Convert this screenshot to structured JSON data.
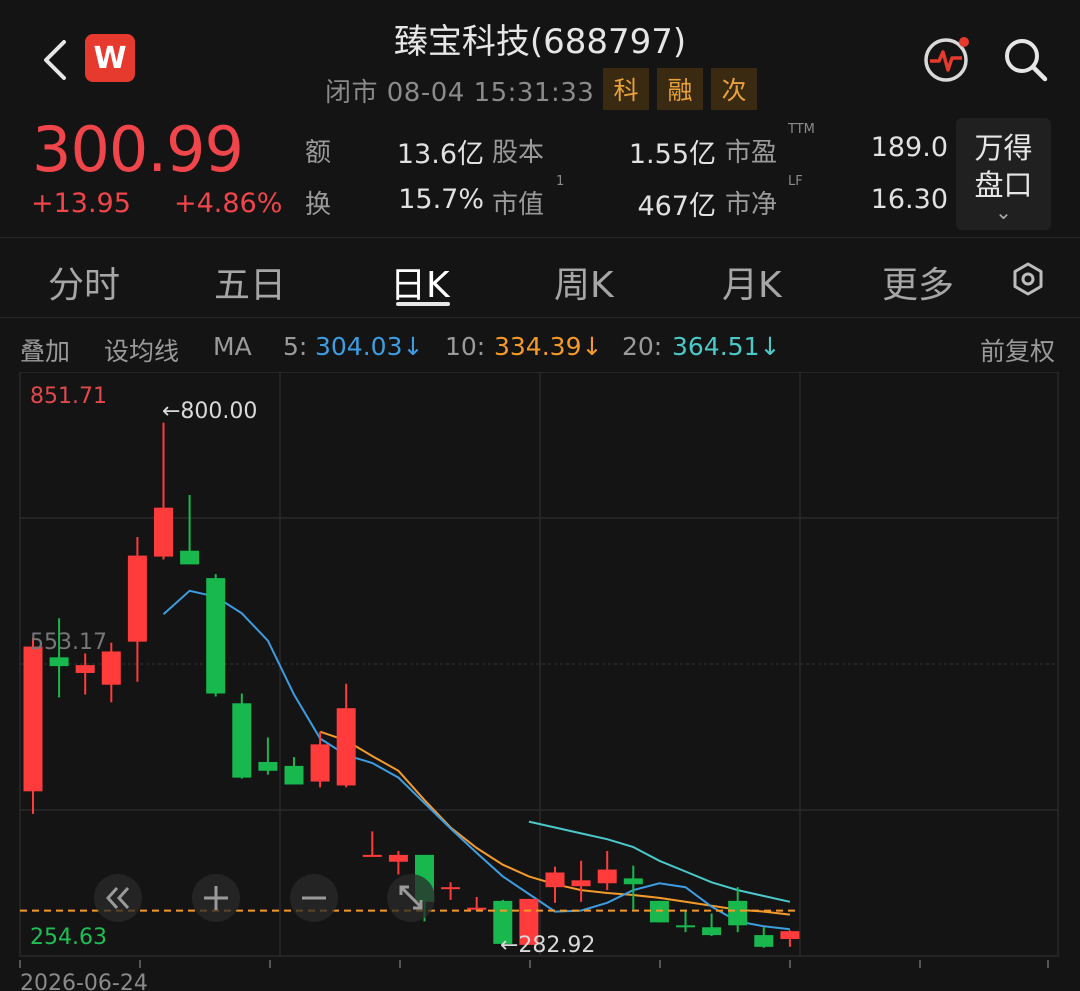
{
  "header": {
    "title": "臻宝科技(688797)",
    "status": "闭市 08-04 15:31:33",
    "tags": [
      "科",
      "融",
      "次"
    ],
    "logo_letter": "W",
    "back_icon": "chevron-left-icon",
    "pulse_icon": "heart-rate-icon",
    "search_icon": "search-icon"
  },
  "quote": {
    "price": "300.99",
    "change": "+13.95",
    "change_pct": "+4.86%",
    "stats": [
      {
        "label": "额",
        "value": "13.6亿"
      },
      {
        "label": "股本",
        "value": "1.55亿"
      },
      {
        "label": "市盈",
        "sup": "TTM",
        "value": "189.0"
      },
      {
        "label": "换",
        "value": "15.7%"
      },
      {
        "label": "市值",
        "sup": "1",
        "value": "467亿"
      },
      {
        "label": "市净",
        "sup": "LF",
        "value": "16.30"
      }
    ],
    "pankou_label": "万得\n盘口",
    "pankou_line1": "万得",
    "pankou_line2": "盘口",
    "pankou_caret": "⌄"
  },
  "tabs": [
    {
      "label": "分时"
    },
    {
      "label": "五日"
    },
    {
      "label": "日K",
      "active": true
    },
    {
      "label": "周K"
    },
    {
      "label": "月K"
    },
    {
      "label": "更多"
    }
  ],
  "toolbar": {
    "overlay": "叠加",
    "set_ma": "设均线",
    "ma": "MA",
    "ma5_label": "5:",
    "ma5_value": "304.03↓",
    "ma10_label": "10:",
    "ma10_value": "334.39↓",
    "ma20_label": "20:",
    "ma20_value": "364.51↓",
    "adjust": "前复权"
  },
  "colors": {
    "up": "#ff3b3b",
    "down": "#18b84f",
    "ma5": "#3d9de0",
    "ma10": "#f39a2b",
    "ma20": "#4bc9c9",
    "last_price_line": "#f39a2b"
  },
  "chart_data": {
    "type": "candlestick",
    "y_top_label": "851.71",
    "y_mid_label": "553.17",
    "y_bottom_label": "254.63",
    "ylim": [
      254.63,
      851.71
    ],
    "max_label": "←800.00",
    "min_label": "←282.92",
    "x_start_label": "2026-06-24",
    "last_price": 300.99,
    "candles": [
      {
        "o": 423,
        "h": 580,
        "l": 400,
        "c": 571
      },
      {
        "o": 560,
        "h": 600,
        "l": 519,
        "c": 551
      },
      {
        "o": 544,
        "h": 564,
        "l": 522,
        "c": 552
      },
      {
        "o": 532,
        "h": 575,
        "l": 514,
        "c": 566
      },
      {
        "o": 576,
        "h": 683,
        "l": 535,
        "c": 664
      },
      {
        "o": 663,
        "h": 800,
        "l": 660,
        "c": 713
      },
      {
        "o": 669,
        "h": 726,
        "l": 661,
        "c": 655
      },
      {
        "o": 641,
        "h": 645,
        "l": 520,
        "c": 523
      },
      {
        "o": 513,
        "h": 523,
        "l": 436,
        "c": 437
      },
      {
        "o": 453,
        "h": 478,
        "l": 440,
        "c": 444
      },
      {
        "o": 449,
        "h": 458,
        "l": 430,
        "c": 430
      },
      {
        "o": 433,
        "h": 484,
        "l": 427,
        "c": 471
      },
      {
        "o": 429,
        "h": 533,
        "l": 427,
        "c": 508
      },
      {
        "o": 357,
        "h": 382,
        "l": 357,
        "c": 358
      },
      {
        "o": 351,
        "h": 362,
        "l": 338,
        "c": 358
      },
      {
        "o": 358,
        "h": 358,
        "l": 290,
        "c": 310
      },
      {
        "o": 325,
        "h": 330,
        "l": 312,
        "c": 325
      },
      {
        "o": 303,
        "h": 315,
        "l": 302,
        "c": 304
      },
      {
        "o": 311,
        "h": 312,
        "l": 265,
        "c": 267
      },
      {
        "o": 266,
        "h": 313,
        "l": 283,
        "c": 313
      },
      {
        "o": 325,
        "h": 346,
        "l": 309,
        "c": 340
      },
      {
        "o": 326,
        "h": 352,
        "l": 310,
        "c": 332
      },
      {
        "o": 329,
        "h": 362,
        "l": 322,
        "c": 343
      },
      {
        "o": 334,
        "h": 347,
        "l": 302,
        "c": 328
      },
      {
        "o": 311,
        "h": 311,
        "l": 289,
        "c": 289
      },
      {
        "o": 286,
        "h": 302,
        "l": 279,
        "c": 285
      },
      {
        "o": 284,
        "h": 298,
        "l": 275,
        "c": 276
      },
      {
        "o": 311,
        "h": 325,
        "l": 279,
        "c": 286
      },
      {
        "o": 276,
        "h": 284,
        "l": 263,
        "c": 264
      },
      {
        "o": 272,
        "h": 281,
        "l": 264,
        "c": 280
      }
    ],
    "ma5_series": [
      null,
      null,
      null,
      null,
      null,
      604,
      628,
      622,
      605,
      577,
      522,
      477,
      460,
      452,
      437,
      411,
      385,
      360,
      336,
      318,
      300,
      301,
      309,
      322,
      329,
      325,
      305,
      290,
      285,
      282
    ],
    "ma10_series": [
      null,
      null,
      null,
      null,
      null,
      null,
      null,
      null,
      null,
      null,
      null,
      484,
      475,
      459,
      444,
      414,
      386,
      365,
      348,
      336,
      328,
      322,
      319,
      317,
      314,
      310,
      306,
      302,
      300,
      297
    ],
    "ma20_series": [
      null,
      null,
      null,
      null,
      null,
      null,
      null,
      null,
      null,
      null,
      null,
      null,
      null,
      null,
      null,
      null,
      null,
      null,
      null,
      392,
      386,
      380,
      374,
      366,
      352,
      341,
      330,
      322,
      316,
      310
    ],
    "controls": [
      "rewind-icon",
      "zoom-in-icon",
      "zoom-out-icon",
      "fullscreen-icon"
    ]
  }
}
